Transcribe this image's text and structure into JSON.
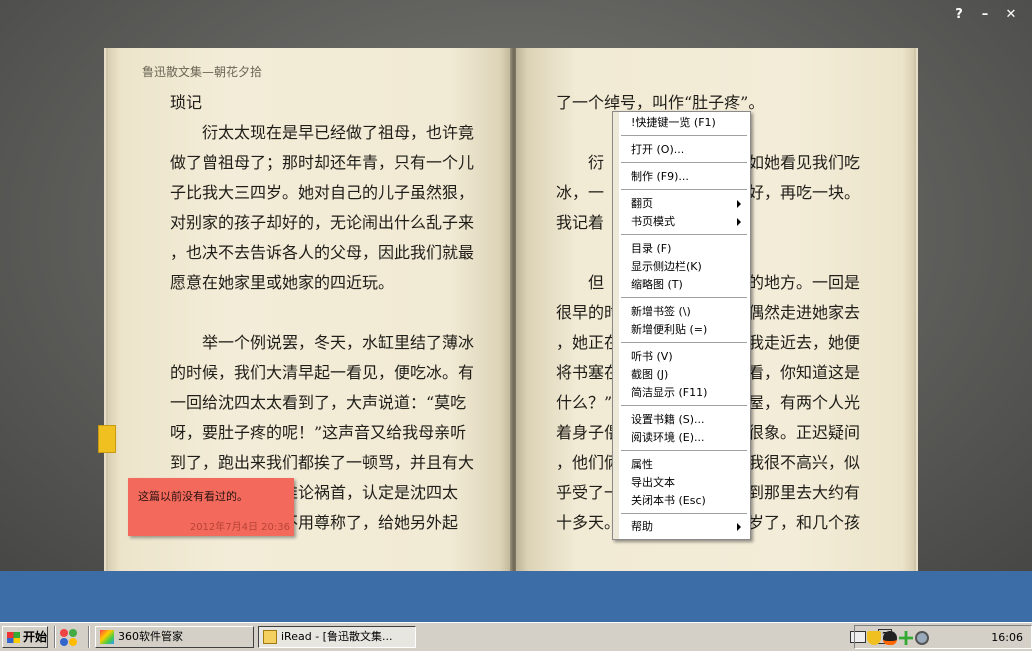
{
  "window_controls": {
    "help": "?",
    "minimize": "–",
    "close": "✕"
  },
  "book": {
    "header": "鲁迅散文集—朝花夕拾",
    "left_lines": [
      "琐记",
      "　　衍太太现在是早已经做了祖母，也许竟",
      "做了曾祖母了；那时却还年青，只有一个儿",
      "子比我大三四岁。她对自己的儿子虽然狠，",
      "对别家的孩子却好的，无论闹出什么乱子来",
      "，也决不去告诉各人的父母，因此我们就最",
      "愿意在她家里或她家的四近玩。",
      "",
      "　　举一个例说罢，冬天，水缸里结了薄冰",
      "的时候，我们大清早起一看见，便吃冰。有",
      "一回给沈四太太看到了，大声说道：“莫吃",
      "呀，要肚子疼的呢！”这声音又给我母亲听",
      "到了，跑出来我们都挨了一顿骂，并且有大",
      "　　　　　　　推论祸首，认定是沈四太",
      "　　　　　　　不用尊称了，给她另外起"
    ],
    "right_lines": [
      "了一个绰号，叫作“肚子疼”。",
      "",
      "　　衍",
      "冰，一",
      "我记着",
      "",
      "　　但",
      "很早的时",
      "，她正在",
      "将书塞在",
      "什么？”",
      "着身子偎",
      "，他们俩",
      "乎受了一",
      "十多天。"
    ],
    "right_lines_far": [
      "",
      "",
      "如她看见我们吃",
      "好，再吃一块。",
      "",
      "",
      "的地方。一回是",
      "偶然走进她家去",
      "我走近去，她便",
      "看，你知道这是",
      "屋，有两个人光",
      "很象。正迟疑间",
      "我很不高兴，似",
      "到那里去大约有",
      "岁了，和几个孩"
    ]
  },
  "sticky_note": {
    "text": "这篇以前没有看过的。",
    "time": "2012年7月4日 20:36"
  },
  "menu": {
    "shortcuts": "!快捷键一览 (F1)",
    "open": "打开 (O)...",
    "make": "制作 (F9)...",
    "flip": "翻页",
    "page_mode": "书页模式",
    "toc": "目录 (F)",
    "sidebar": "显示侧边栏(K)",
    "thumbnail": "缩略图 (T)",
    "add_bookmark": "新增书签 (\\)",
    "add_sticky": "新增便利贴 (=)",
    "listen": "听书 (V)",
    "screenshot": "截图 (J)",
    "simple_view": "简洁显示 (F11)",
    "book_settings": "设置书籍 (S)...",
    "reading_env": "阅读环境 (E)...",
    "properties": "属性",
    "export_text": "导出文本",
    "close_book": "关闭本书 (Esc)",
    "help": "帮助"
  },
  "taskbar": {
    "start": "开始",
    "tasks": [
      "360软件管家",
      "iRead - [鲁迅散文集..."
    ],
    "clock": "16:06"
  },
  "colors": {
    "sticky": "#f36a5c",
    "desktop": "#3d6da6",
    "bookmark": "#f0c020"
  }
}
